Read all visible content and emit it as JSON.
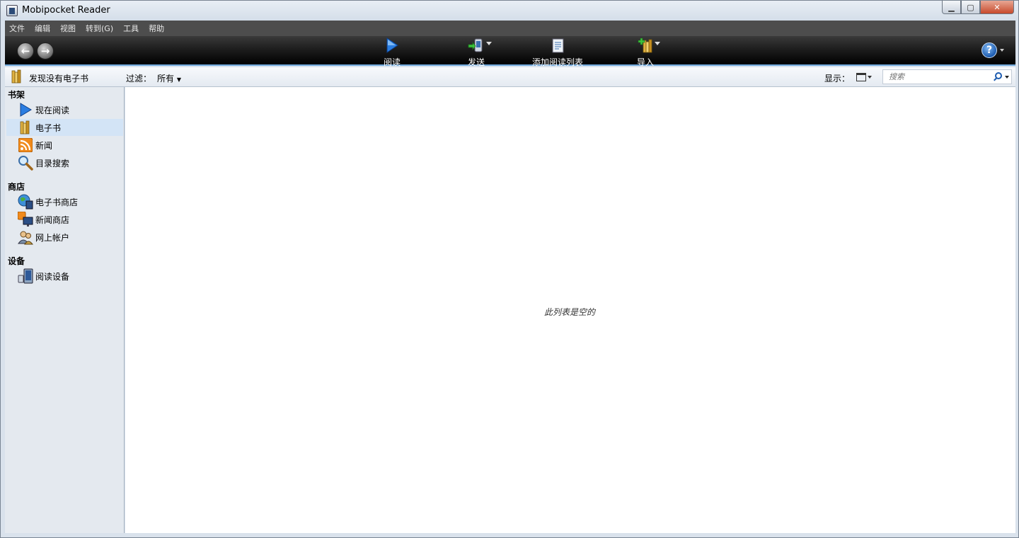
{
  "window": {
    "title": "Mobipocket Reader",
    "controls": [
      "minimize",
      "maximize",
      "close"
    ]
  },
  "menubar": {
    "items": [
      {
        "label": "文件"
      },
      {
        "label": "编辑"
      },
      {
        "label": "视图"
      },
      {
        "label": "转到(G)"
      },
      {
        "label": "工具"
      },
      {
        "label": "帮助"
      }
    ]
  },
  "toolbar": {
    "back_icon": "back-arrow-icon",
    "forward_icon": "forward-arrow-icon",
    "buttons": [
      {
        "label": "阅读",
        "icon": "play-icon"
      },
      {
        "label": "发送",
        "icon": "send-device-icon"
      },
      {
        "label": "添加阅读列表",
        "icon": "reading-list-icon"
      },
      {
        "label": "导入",
        "icon": "import-books-icon"
      }
    ],
    "help_label": "?"
  },
  "filterbar": {
    "status": "发现没有电子书",
    "filter_label": "过滤：",
    "filter_value": "所有",
    "display_label": "显示：",
    "search_placeholder": "搜索"
  },
  "sidebar": {
    "sections": [
      {
        "header": "书架",
        "items": [
          {
            "label": "现在阅读",
            "icon": "play-icon"
          },
          {
            "label": "电子书",
            "icon": "books-icon",
            "selected": true
          },
          {
            "label": "新闻",
            "icon": "rss-icon"
          },
          {
            "label": "目录搜索",
            "icon": "magnifier-icon"
          }
        ]
      },
      {
        "header": "商店",
        "items": [
          {
            "label": "电子书商店",
            "icon": "globe-store-icon"
          },
          {
            "label": "新闻商店",
            "icon": "news-store-icon"
          },
          {
            "label": "网上帐户",
            "icon": "users-icon"
          }
        ]
      },
      {
        "header": "设备",
        "items": [
          {
            "label": "阅读设备",
            "icon": "device-icon"
          }
        ]
      }
    ]
  },
  "main": {
    "empty_message": "此列表是空的"
  },
  "colors": {
    "toolbar_bg": "#1e1e1e",
    "menubar_bg": "#4d4d4d",
    "sidebar_bg": "#e4e9ef",
    "selected_bg": "#d3e4f6",
    "accent_blue": "#1d5cb0"
  }
}
